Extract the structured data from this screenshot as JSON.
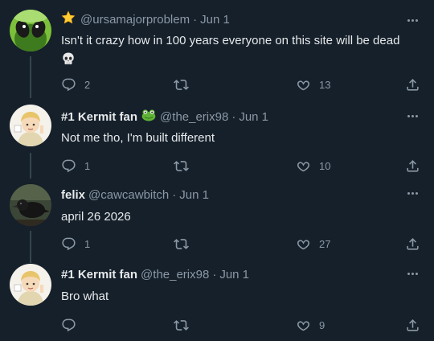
{
  "tweets": [
    {
      "display_name": "",
      "handle": "@ursamajorproblem",
      "date": "Jun 1",
      "text": "Isn't it crazy how in 100 years everyone on this site will be dead",
      "emoji": "💀",
      "reply_count": "2",
      "retweet_count": "",
      "like_count": "13"
    },
    {
      "display_name": "#1 Kermit fan",
      "handle": "@the_erix98",
      "date": "Jun 1",
      "text": "Not me tho, I'm built different",
      "reply_count": "1",
      "retweet_count": "",
      "like_count": "10"
    },
    {
      "display_name": "felix",
      "handle": "@cawcawbitch",
      "date": "Jun 1",
      "text": "april 26 2026",
      "reply_count": "1",
      "retweet_count": "",
      "like_count": "27"
    },
    {
      "display_name": "#1 Kermit fan",
      "handle": "@the_erix98",
      "date": "Jun 1",
      "text": "Bro what",
      "reply_count": "",
      "retweet_count": "",
      "like_count": "9"
    }
  ],
  "separator": "·",
  "icons": {
    "badge": "star-icon",
    "frog": "frog-icon",
    "skull": "skull-icon",
    "more": "more-options-icon",
    "reply": "reply-icon",
    "retweet": "retweet-icon",
    "like": "like-icon",
    "share": "share-icon"
  },
  "colors": {
    "background": "#15202b",
    "text": "#e7e9ea",
    "muted": "#8b98a5",
    "thread_line": "#38444d"
  }
}
